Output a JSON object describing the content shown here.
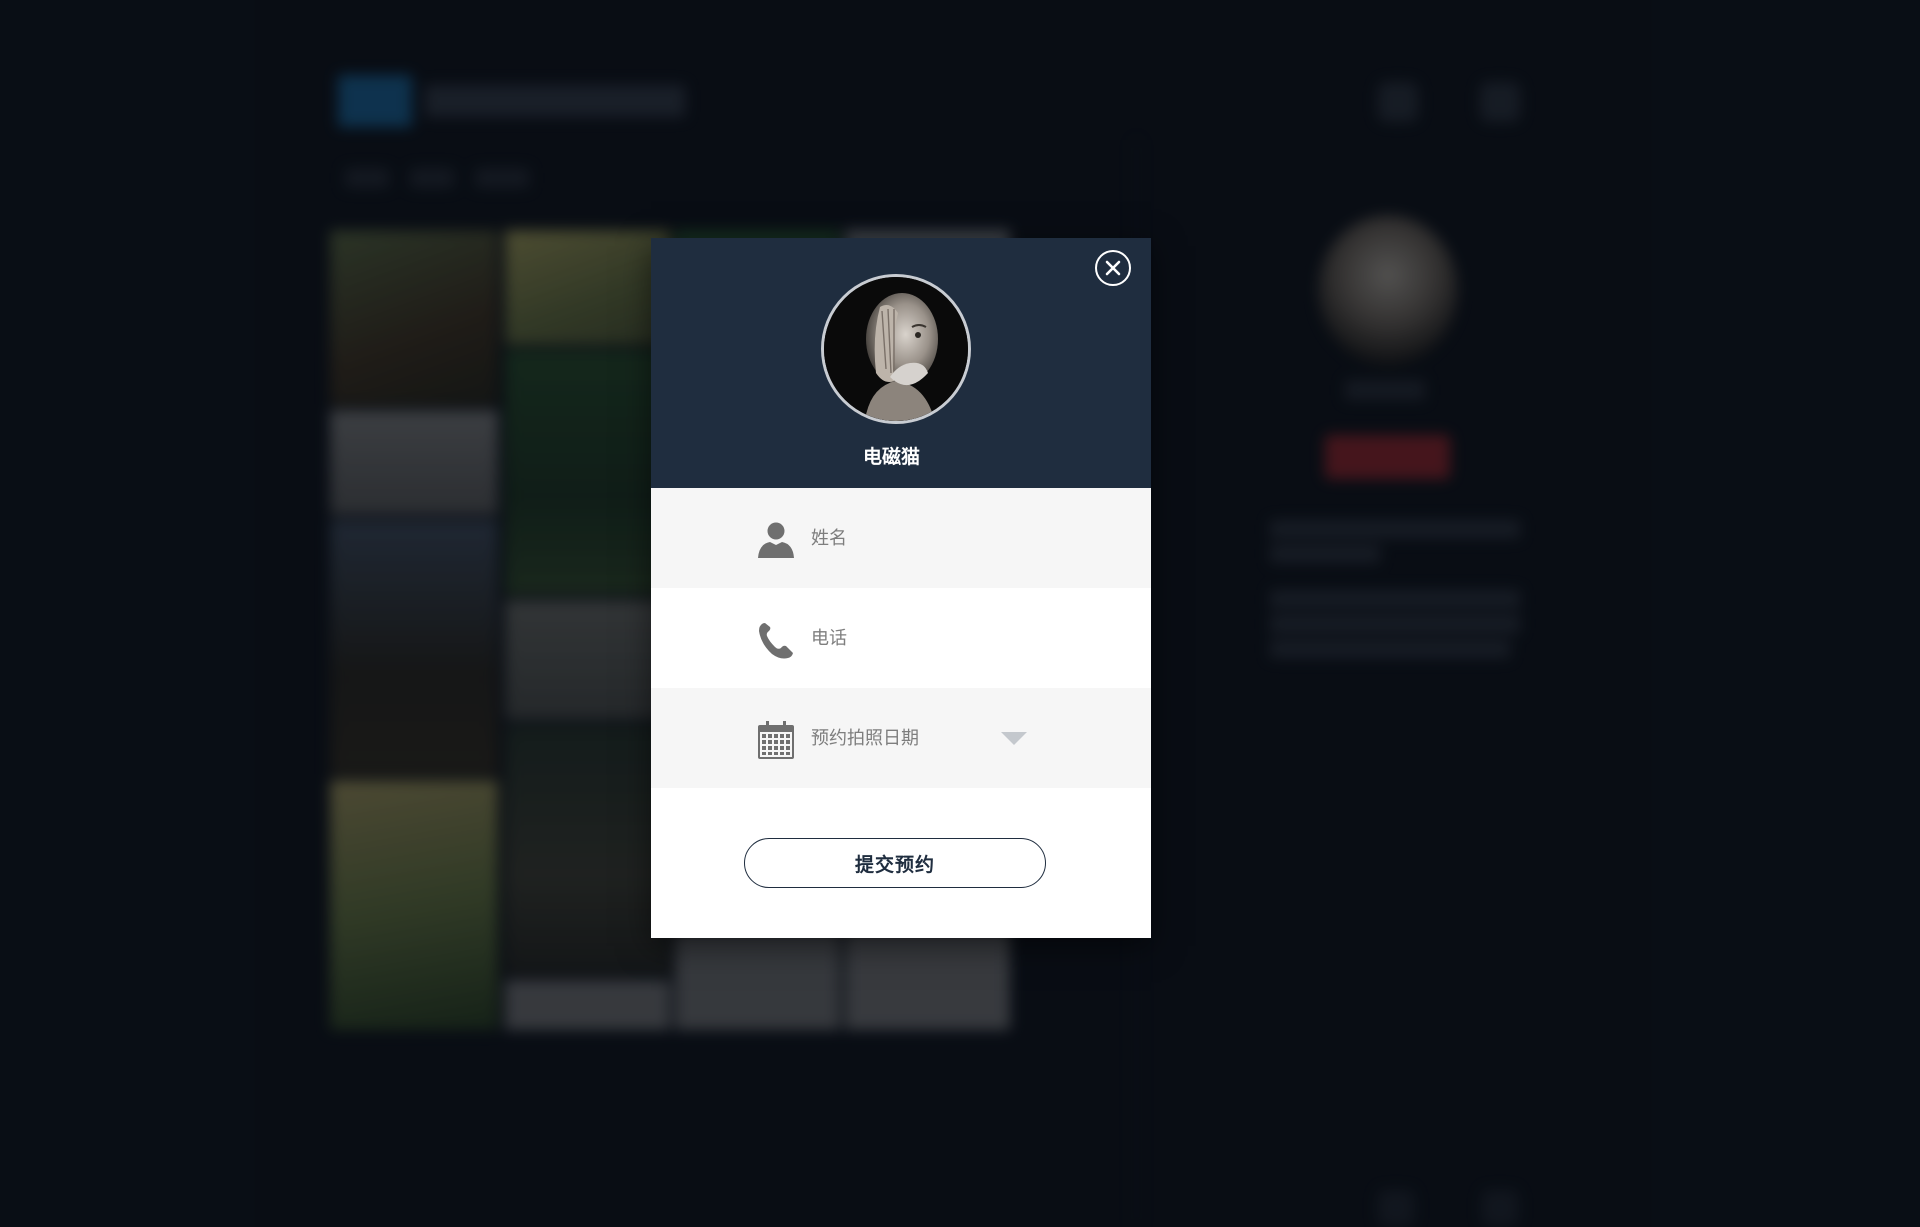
{
  "modal": {
    "photographer_name": "电磁猫",
    "fields": {
      "name_placeholder": "姓名",
      "phone_placeholder": "电话",
      "date_placeholder": "预约拍照日期"
    },
    "submit_label": "提交预约"
  },
  "icons": {
    "close": "close-icon",
    "name": "user-icon",
    "phone": "phone-icon",
    "date": "calendar-icon",
    "dropdown": "chevron-down-icon"
  },
  "colors": {
    "backdrop": "#0b1018",
    "modal_header": "#1f2d3f",
    "field_alt": "#f6f6f6",
    "icon_gray": "#6f6f6f",
    "caret_gray": "#c4c8cd"
  }
}
